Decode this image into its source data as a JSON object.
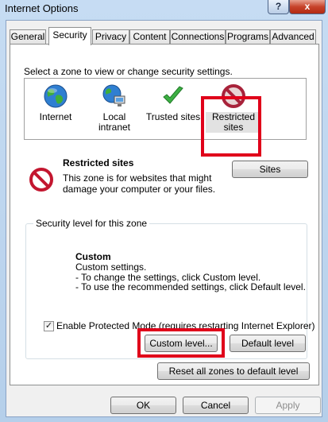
{
  "window": {
    "title": "Internet Options",
    "help_glyph": "?",
    "close_glyph": "x"
  },
  "tabs": [
    {
      "label": "General"
    },
    {
      "label": "Security",
      "active": true
    },
    {
      "label": "Privacy"
    },
    {
      "label": "Content"
    },
    {
      "label": "Connections"
    },
    {
      "label": "Programs"
    },
    {
      "label": "Advanced"
    }
  ],
  "security": {
    "zone_prompt": "Select a zone to view or change security settings.",
    "zones": [
      {
        "label": "Internet",
        "icon": "globe-icon"
      },
      {
        "label": "Local intranet",
        "icon": "intranet-globe-icon"
      },
      {
        "label": "Trusted sites",
        "icon": "check-icon"
      },
      {
        "label_line1": "Restricted",
        "label_line2": "sites",
        "icon": "restricted-icon",
        "selected": true
      }
    ],
    "selected_zone": {
      "title": "Restricted sites",
      "description": "This zone is for websites that might damage your computer or your files.",
      "sites_button": "Sites"
    },
    "level_group_title": "Security level for this zone",
    "level": {
      "title": "Custom",
      "line1": "Custom settings.",
      "line2": "- To change the settings, click Custom level.",
      "line3": "- To use the recommended settings, click Default level."
    },
    "protected_mode": {
      "label": "Enable Protected Mode (requires restarting Internet Explorer)",
      "checked": true,
      "check_glyph": "✓"
    },
    "custom_level_button": "Custom level...",
    "default_level_button": "Default level",
    "reset_all_button": "Reset all zones to default level"
  },
  "footer": {
    "ok": "OK",
    "cancel": "Cancel",
    "apply": "Apply",
    "apply_disabled": true
  },
  "colors": {
    "highlight_box": "#e0001a",
    "titlebar": "#c6dcf3",
    "close_button": "#c7432b"
  }
}
